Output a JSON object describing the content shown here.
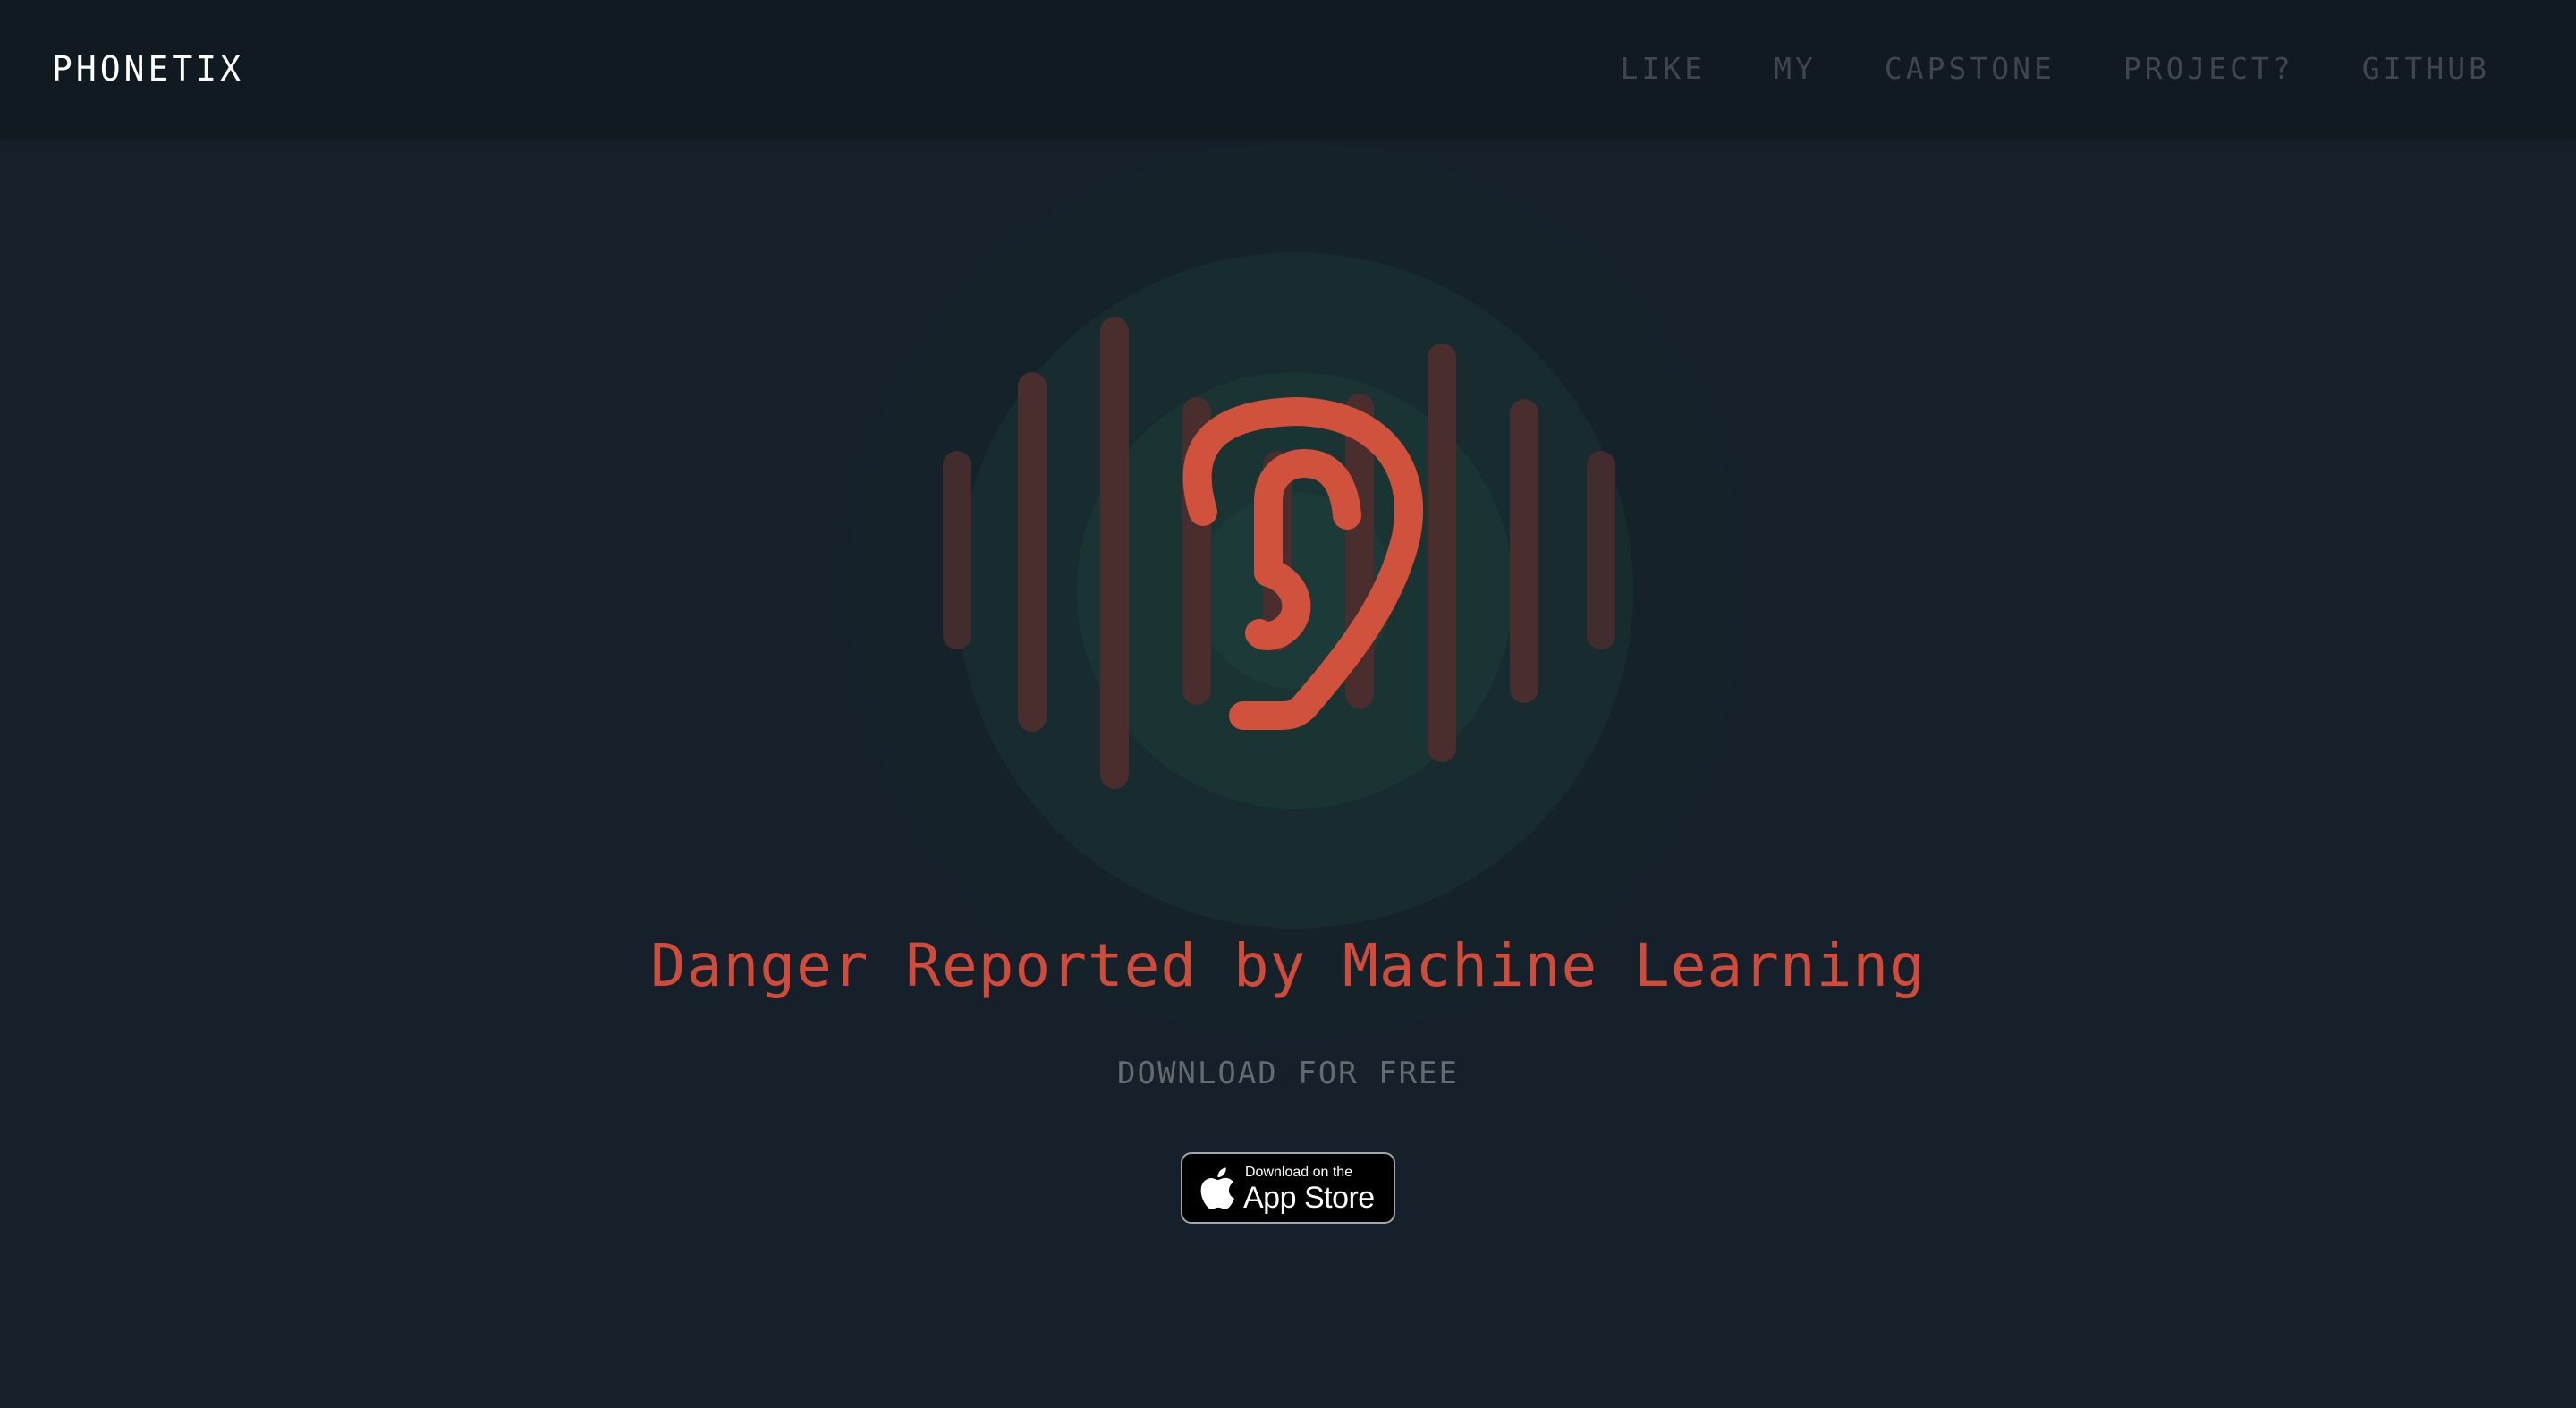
{
  "header": {
    "brand": "PHONETIX",
    "nav": [
      {
        "label": "LIKE"
      },
      {
        "label": "MY"
      },
      {
        "label": "CAPSTONE"
      },
      {
        "label": "PROJECT?"
      },
      {
        "label": "GITHUB"
      }
    ]
  },
  "hero": {
    "icon": "ear-icon",
    "headline": "Danger Reported by Machine Learning",
    "subline": "DOWNLOAD FOR FREE"
  },
  "store_badge": {
    "small_text": "Download on the",
    "big_text": "App Store",
    "icon": "apple-icon"
  },
  "colors": {
    "background": "#15202a",
    "topbar": "#111a20",
    "accent": "#d1523c",
    "nav_text": "#3f474d",
    "subline_text": "#646b70"
  }
}
